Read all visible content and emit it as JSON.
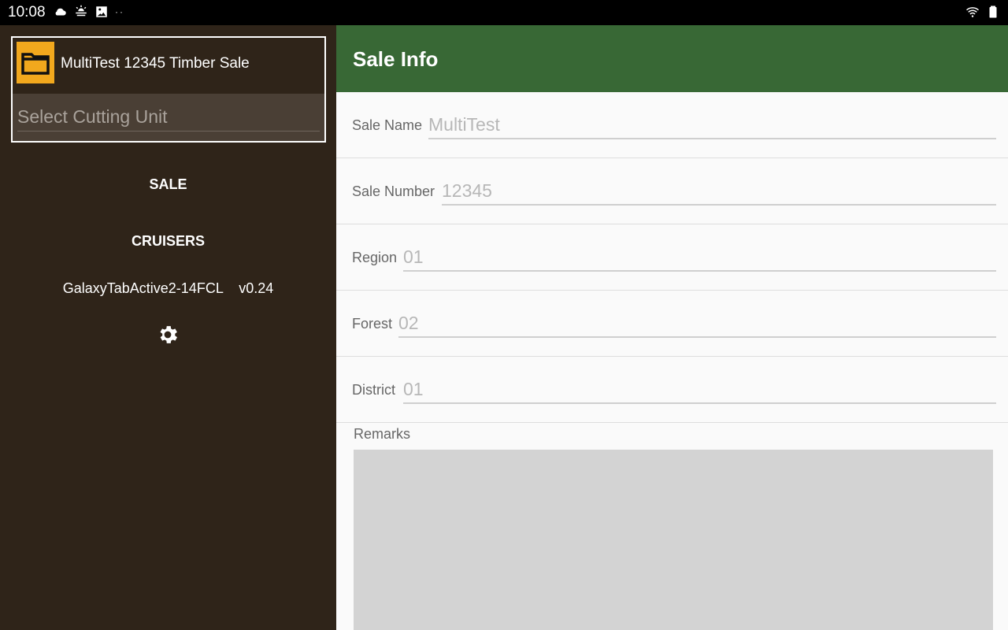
{
  "statusbar": {
    "time": "10:08",
    "icons_left": [
      "cloud-icon",
      "weather-icon",
      "gallery-icon"
    ],
    "dots": "··",
    "icons_right": [
      "wifi-icon",
      "battery-icon"
    ]
  },
  "sidebar": {
    "sale_title": "MultiTest 12345 Timber Sale",
    "cutting_unit_placeholder": "Select Cutting Unit",
    "nav": {
      "sale": "SALE",
      "cruisers": "CRUISERS"
    },
    "device_name": "GalaxyTabActive2-14FCL",
    "version": "v0.24",
    "settings_icon": "gear-icon"
  },
  "main": {
    "title": "Sale Info",
    "fields": [
      {
        "label": "Sale Name",
        "value": "MultiTest"
      },
      {
        "label": "Sale Number",
        "value": "12345"
      },
      {
        "label": "Region",
        "value": "01"
      },
      {
        "label": "Forest",
        "value": "02"
      },
      {
        "label": "District",
        "value": "01"
      }
    ],
    "remarks_label": "Remarks",
    "remarks_value": ""
  },
  "colors": {
    "sidebar_bg": "#2f2419",
    "header_bg": "#386835",
    "folder_accent": "#f2a81d",
    "remarks_bg": "#d3d3d3"
  }
}
